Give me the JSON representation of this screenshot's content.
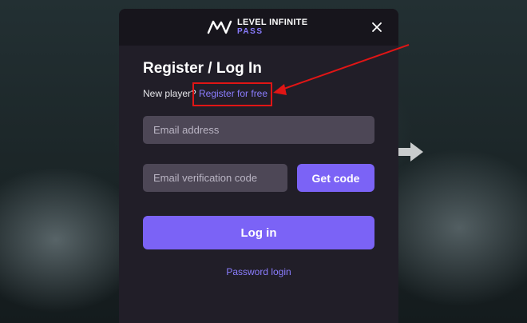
{
  "header": {
    "logo_line1": "LEVEL INFINITE",
    "logo_line2": "PASS",
    "logo_icon": "level-infinite-logo-icon",
    "close_icon": "close-icon"
  },
  "form": {
    "title": "Register / Log In",
    "new_player_text": "New player?",
    "register_link": "Register for free",
    "email_placeholder": "Email address",
    "code_placeholder": "Email verification code",
    "get_code_label": "Get code",
    "login_label": "Log in",
    "password_login_label": "Password login"
  },
  "colors": {
    "accent": "#7b63f6",
    "link": "#8b7dff",
    "annotation": "#e01515",
    "modal_bg": "#211e28",
    "input_bg": "#4d4756"
  }
}
